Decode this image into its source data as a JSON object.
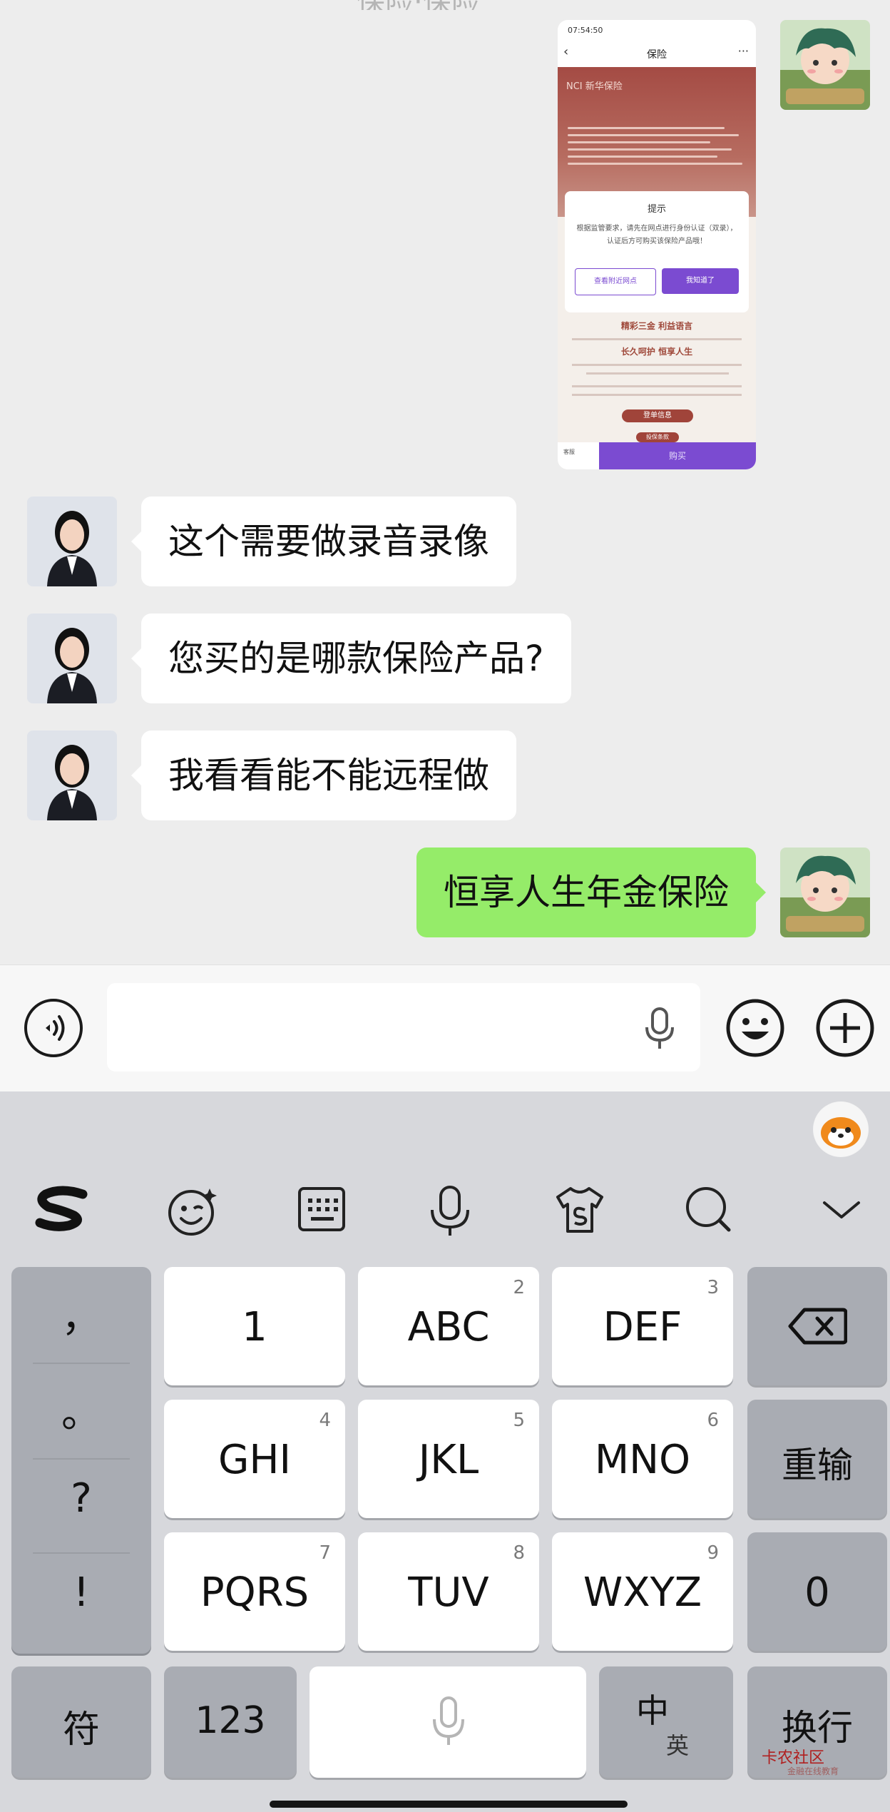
{
  "chat": {
    "top_cut_text": "保险·保险",
    "shot": {
      "time": "07:54:50",
      "title": "保险",
      "brand": "NCI 新华保险",
      "dialog_title": "提示",
      "dialog_body": "根据监管要求，请先在网点进行身份认证（双录），认证后方可购买该保险产品哦！",
      "btn_nearby": "查看附近网点",
      "btn_ok": "我知道了",
      "section1": "精彩三金 利益语言",
      "section2": "长久呵护 恒享人生",
      "pill": "登单信息",
      "pill2": "投保条款",
      "buy": "购买",
      "cs": "客服"
    },
    "messages": [
      {
        "side": "left",
        "text": "这个需要做录音录像"
      },
      {
        "side": "left",
        "text": "您买的是哪款保险产品?"
      },
      {
        "side": "left",
        "text": "我看看能不能远程做"
      },
      {
        "side": "right",
        "text": "恒享人生年金保险"
      }
    ]
  },
  "input": {
    "value": "",
    "placeholder": ""
  },
  "keyboard": {
    "toolbar": [
      "sogou-logo",
      "emoji-wink-icon",
      "keyboard-icon",
      "mic-icon",
      "skin-icon",
      "search-icon",
      "chevron-down-icon"
    ],
    "punct": [
      "，",
      "。",
      "?",
      "!"
    ],
    "rows": [
      [
        {
          "label": "1",
          "num": ""
        },
        {
          "label": "ABC",
          "num": "2"
        },
        {
          "label": "DEF",
          "num": "3"
        }
      ],
      [
        {
          "label": "GHI",
          "num": "4"
        },
        {
          "label": "JKL",
          "num": "5"
        },
        {
          "label": "MNO",
          "num": "6"
        }
      ],
      [
        {
          "label": "PQRS",
          "num": "7"
        },
        {
          "label": "TUV",
          "num": "8"
        },
        {
          "label": "WXYZ",
          "num": "9"
        }
      ]
    ],
    "right_keys": [
      "重输",
      "0"
    ],
    "bottom": {
      "symbol": "符",
      "num_mode": "123",
      "lang_main": "中",
      "lang_sub": "英",
      "enter": "换行"
    }
  },
  "watermark": {
    "main": "卡农社区",
    "sub": "金融在线教育"
  }
}
